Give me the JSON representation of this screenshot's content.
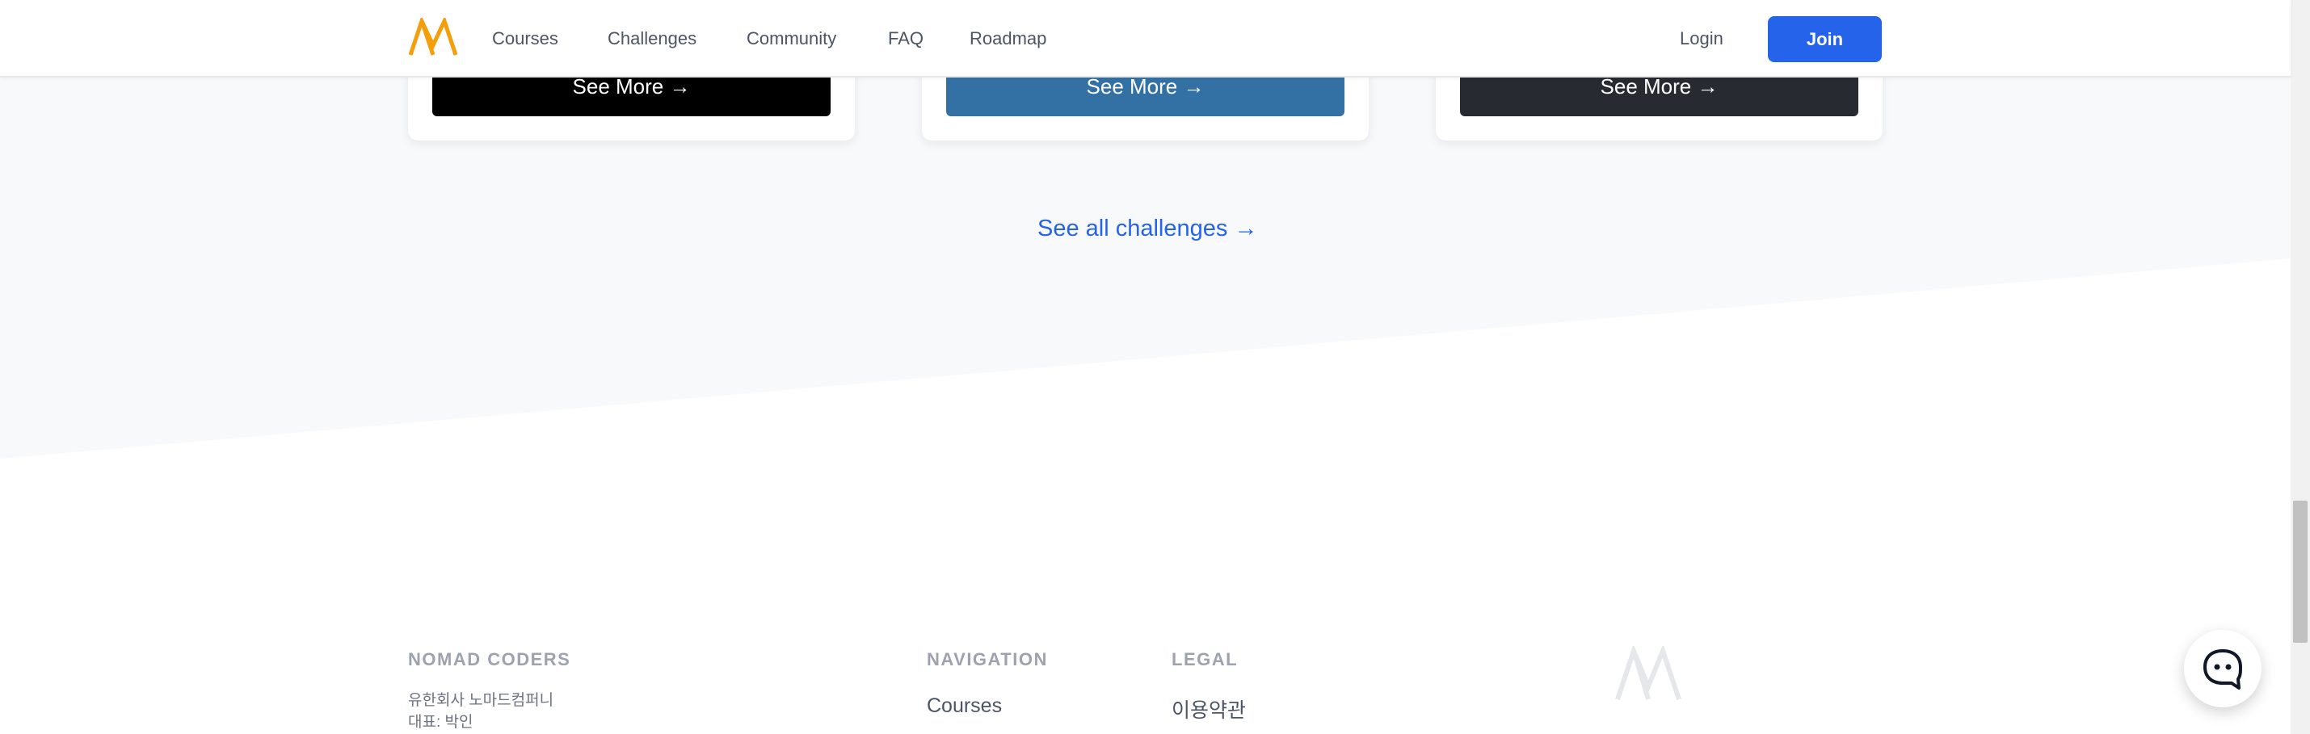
{
  "header": {
    "nav": [
      "Courses",
      "Challenges",
      "Community",
      "FAQ",
      "Roadmap"
    ],
    "login": "Login",
    "join": "Join"
  },
  "cards": [
    {
      "button": "See More →",
      "color": "#000000"
    },
    {
      "button": "See More →",
      "color": "#3370a4"
    },
    {
      "button": "See More →",
      "color": "#272a31"
    }
  ],
  "see_all": "See all challenges →",
  "footer": {
    "company_heading": "NOMAD CODERS",
    "company_line1": "유한회사 노마드컴퍼니",
    "company_line2": "대표: 박인",
    "navigation_heading": "NAVIGATION",
    "navigation_first": "Courses",
    "legal_heading": "LEGAL",
    "legal_first": "이용약관"
  },
  "colors": {
    "brand_orange": "#f59e0b",
    "primary_blue": "#2563eb",
    "light_section": "#f8f9fb"
  },
  "icons": {
    "logo": "nomad-logo-icon",
    "chat": "chat-bubble-icon"
  }
}
